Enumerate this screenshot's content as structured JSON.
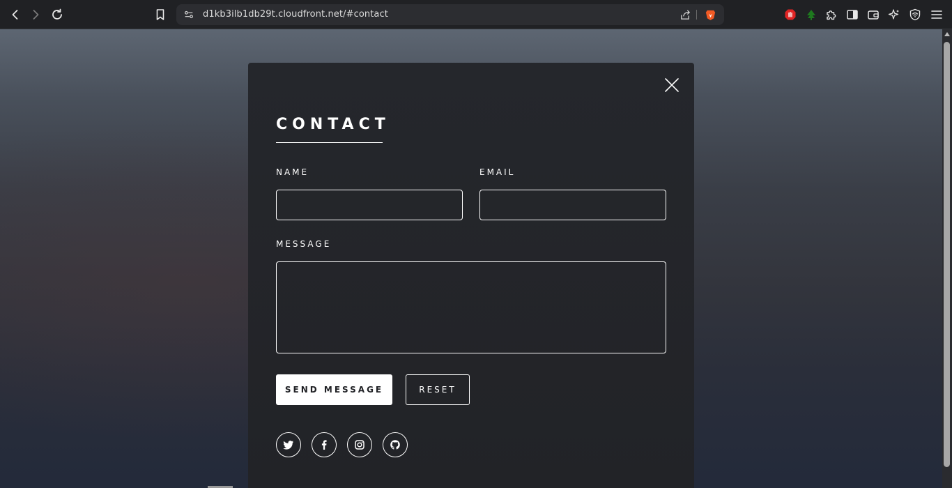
{
  "browser": {
    "url": "d1kb3ilb1db29t.cloudfront.net/#contact",
    "nav_icons": [
      "back-icon",
      "forward-icon",
      "reload-icon",
      "bookmark-icon"
    ],
    "extension_icons": [
      "adblock-icon",
      "tree-extension-icon",
      "puzzle-icon",
      "sidebar-icon",
      "wallet-icon",
      "leo-ai-icon",
      "vpn-shield-icon",
      "menu-icon"
    ]
  },
  "contact": {
    "title": "CONTACT",
    "name_label": "NAME",
    "name_value": "",
    "email_label": "EMAIL",
    "email_value": "",
    "message_label": "MESSAGE",
    "message_value": "",
    "send_label": "SEND MESSAGE",
    "reset_label": "RESET",
    "social": [
      "twitter-icon",
      "facebook-icon",
      "instagram-icon",
      "github-icon"
    ]
  },
  "colors": {
    "modal_bg": "#25272c",
    "text": "#ffffff",
    "toolbar_bg": "#202124"
  }
}
